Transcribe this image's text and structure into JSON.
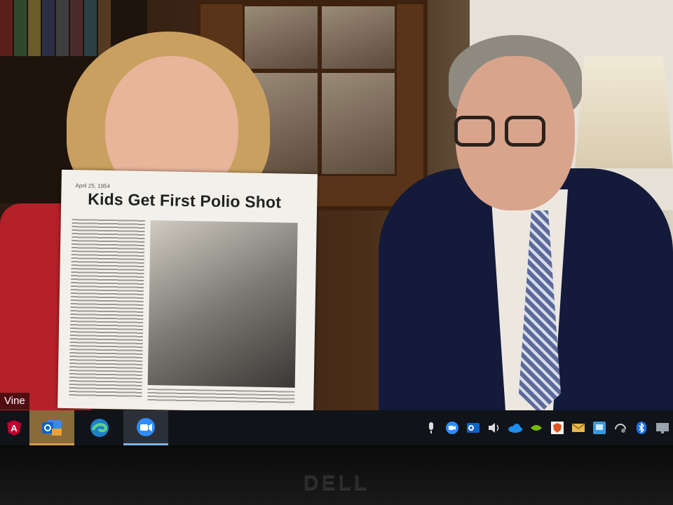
{
  "video": {
    "participant_name": "Vine"
  },
  "newspaper": {
    "date_line": "April 25, 1954",
    "headline": "Kids Get First Polio Shot"
  },
  "taskbar": {
    "apps": [
      {
        "name": "angular-icon",
        "glyph": "A"
      },
      {
        "name": "outlook-icon",
        "glyph": "O"
      },
      {
        "name": "edge-icon",
        "glyph": "e"
      },
      {
        "name": "zoom-icon",
        "glyph": "■"
      }
    ],
    "tray": [
      "microphone-icon",
      "zoom-tray-icon",
      "outlook-tray-icon",
      "volume-icon",
      "onedrive-icon",
      "nvidia-icon",
      "shield-icon",
      "mail-icon",
      "network-icon",
      "headset-icon",
      "bluetooth-icon",
      "display-icon"
    ]
  },
  "monitor": {
    "brand": "DELL"
  },
  "colors": {
    "taskbar_bg": "#101318",
    "active_app": "#8a6a3a",
    "zoom_blue": "#2d8cff",
    "outlook_blue": "#0a64c8",
    "angular_red": "#c3002f"
  }
}
